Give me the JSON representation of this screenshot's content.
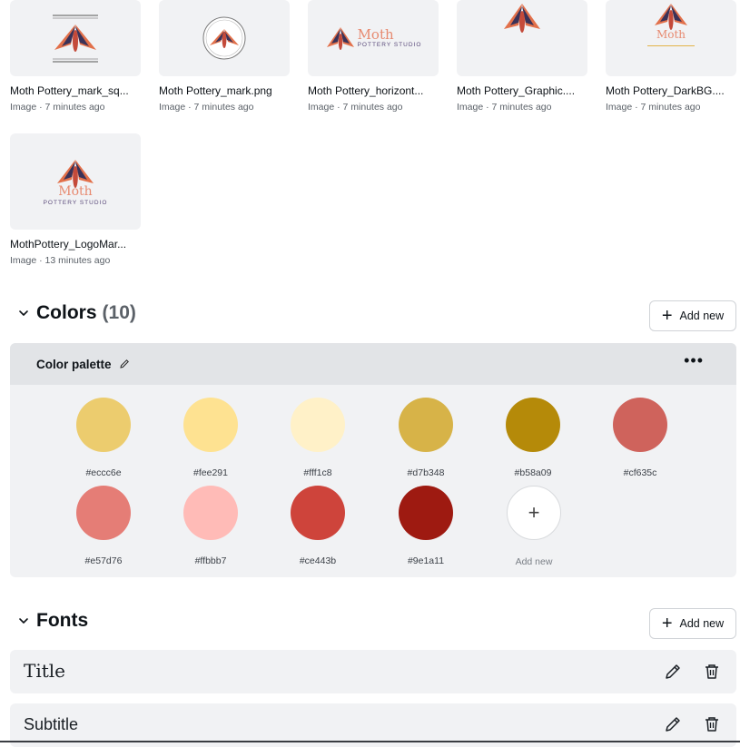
{
  "images": [
    {
      "name": "Moth Pottery_mark_sq...",
      "meta": "Image · 7 minutes ago"
    },
    {
      "name": "Moth Pottery_mark.png",
      "meta": "Image · 7 minutes ago"
    },
    {
      "name": "Moth Pottery_horizont...",
      "meta": "Image · 7 minutes ago",
      "logo_text": "Moth",
      "logo_sub": "POTTERY STUDIO"
    },
    {
      "name": "Moth Pottery_Graphic....",
      "meta": "Image · 7 minutes ago"
    },
    {
      "name": "Moth Pottery_DarkBG....",
      "meta": "Image · 7 minutes ago",
      "logo_text": "Moth"
    },
    {
      "name": "MothPottery_LogoMar...",
      "meta": "Image · 13 minutes ago",
      "logo_text": "Moth",
      "logo_sub": "POTTERY STUDIO"
    }
  ],
  "colors_section": {
    "title": "Colors",
    "count": "(10)",
    "add_new": "Add new",
    "palette_title": "Color palette",
    "swatches": [
      {
        "hex": "#eccc6e",
        "color": "#eccc6e"
      },
      {
        "hex": "#fee291",
        "color": "#fee291"
      },
      {
        "hex": "#fff1c8",
        "color": "#fff1c8"
      },
      {
        "hex": "#d7b348",
        "color": "#d7b348"
      },
      {
        "hex": "#b58a09",
        "color": "#b58a09"
      },
      {
        "hex": "#cf635c",
        "color": "#cf635c"
      },
      {
        "hex": "#e57d76",
        "color": "#e57d76"
      },
      {
        "hex": "#ffbbb7",
        "color": "#ffbbb7"
      },
      {
        "hex": "#ce443b",
        "color": "#ce443b"
      },
      {
        "hex": "#9e1a11",
        "color": "#9e1a11"
      }
    ],
    "add_swatch_label": "Add new"
  },
  "fonts_section": {
    "title": "Fonts",
    "add_new": "Add new",
    "fonts": [
      {
        "label": "Title"
      },
      {
        "label": "Subtitle"
      }
    ]
  }
}
